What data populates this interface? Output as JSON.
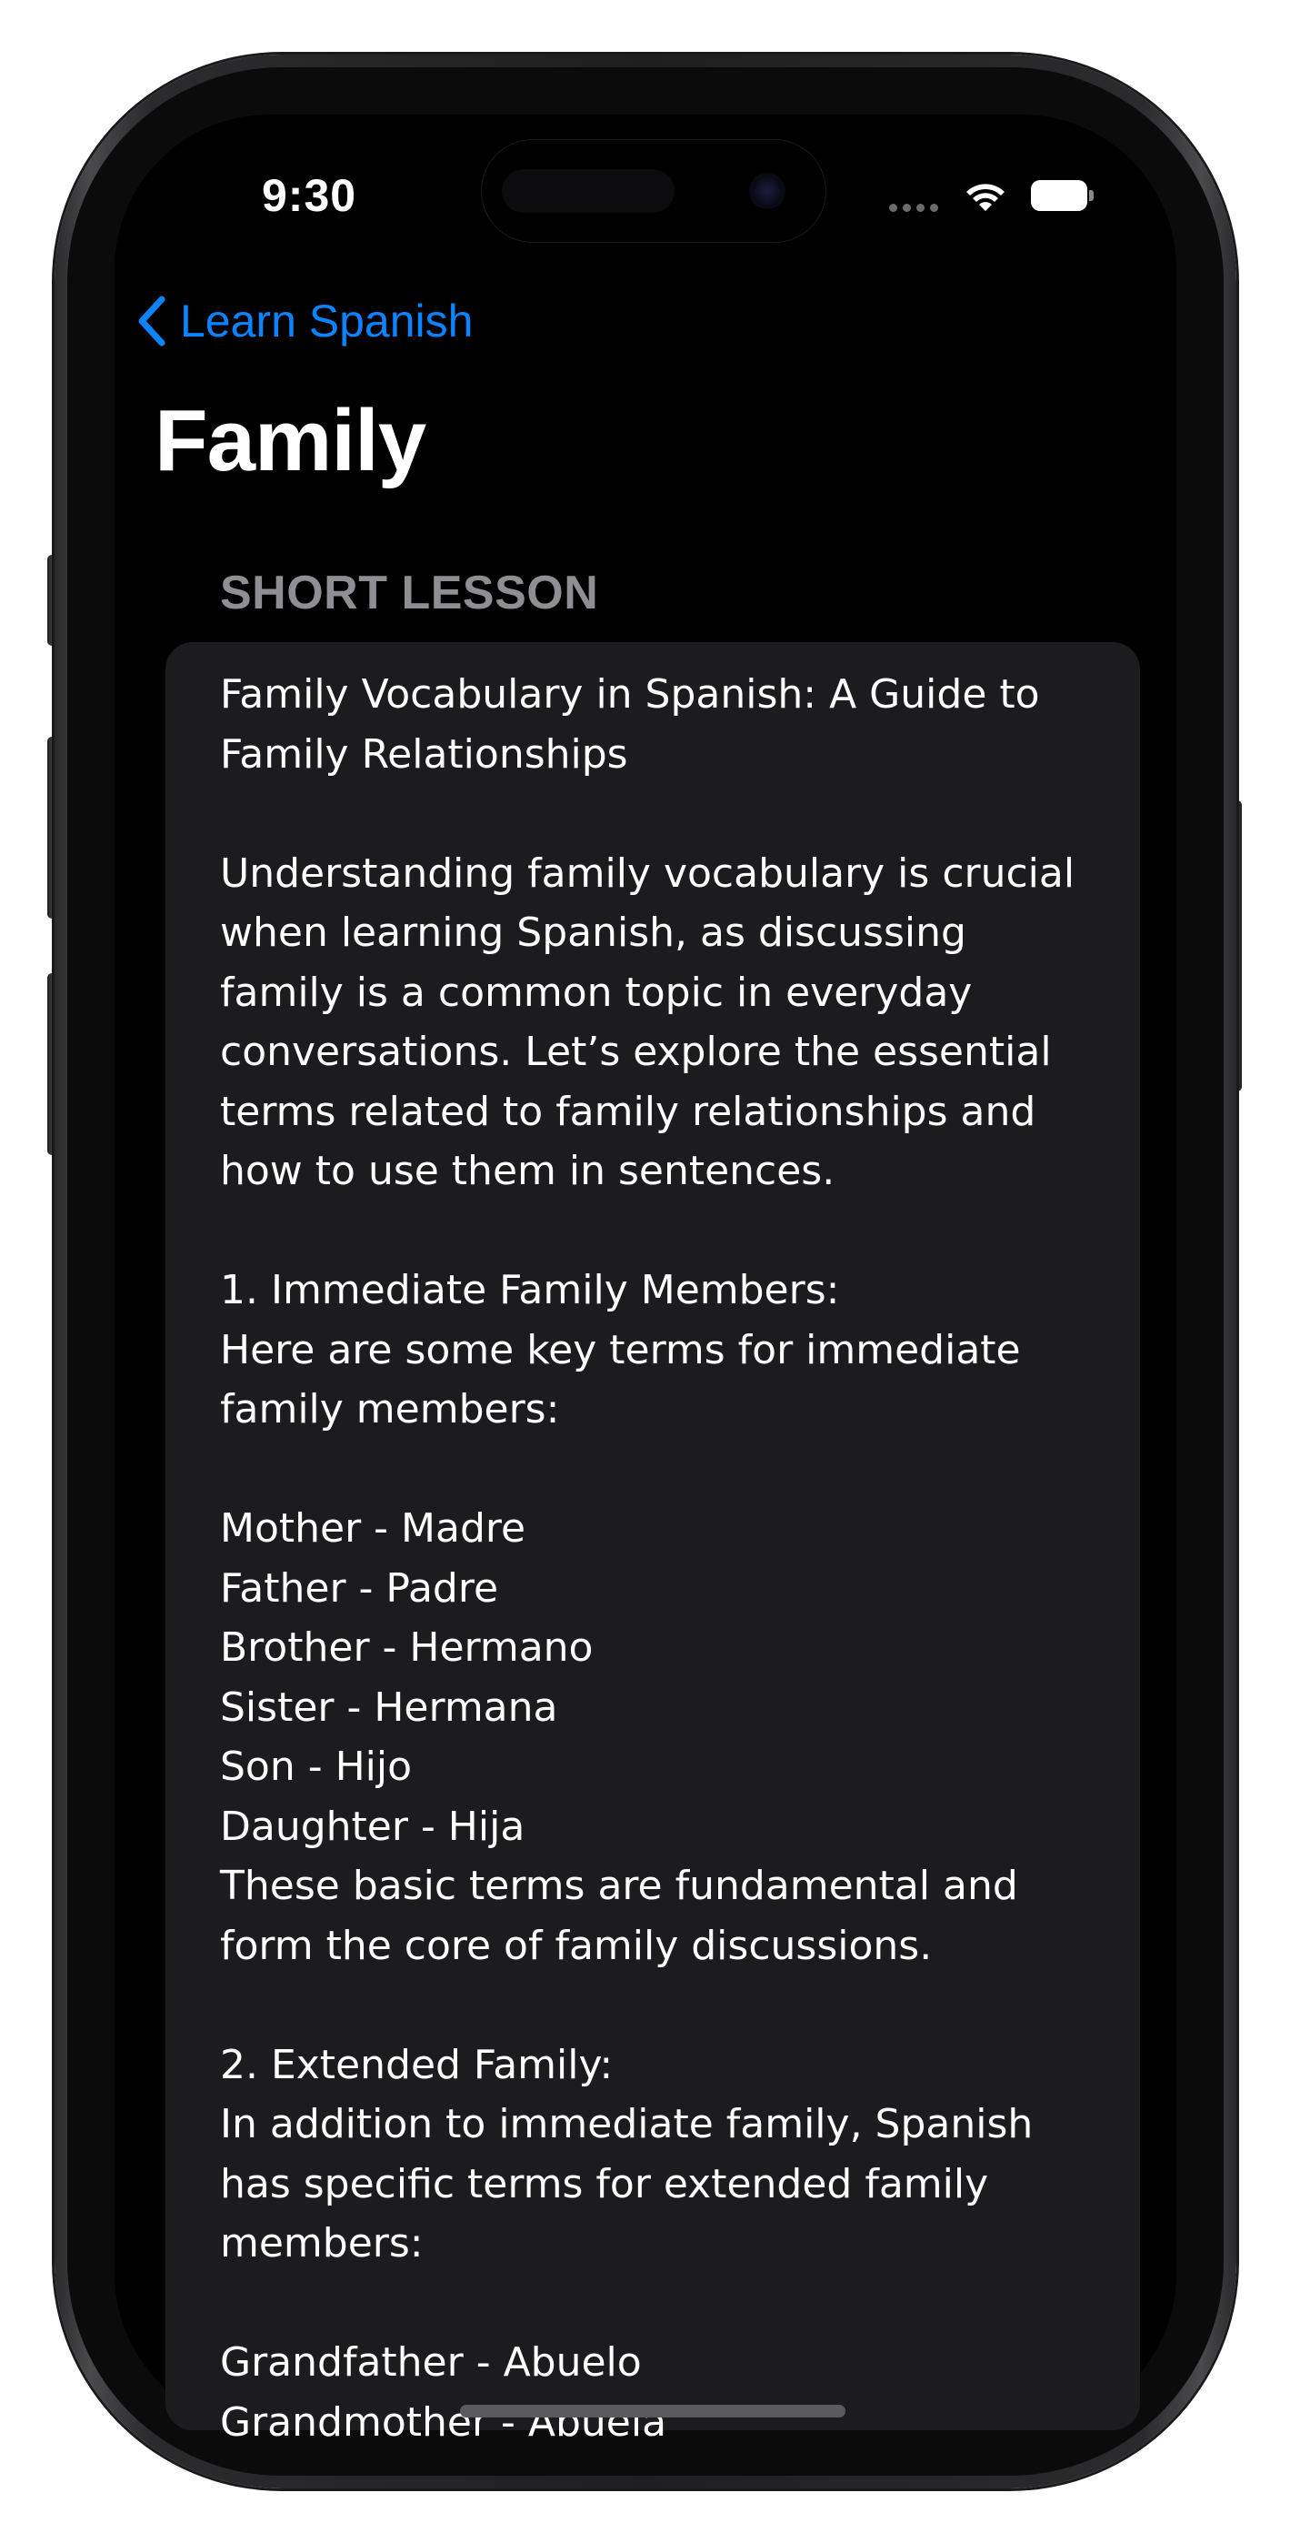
{
  "status_bar": {
    "time": "9:30"
  },
  "nav": {
    "back_label": "Learn Spanish",
    "title": "Family"
  },
  "section": {
    "header": "SHORT LESSON"
  },
  "lesson": {
    "text": "Family Vocabulary in Spanish: A Guide to\nFamily Relationships\n\nUnderstanding family vocabulary is crucial\nwhen learning Spanish, as discussing\nfamily is a common topic in everyday\nconversations. Let’s explore the essential\nterms related to family relationships and\nhow to use them in sentences.\n\n1. Immediate Family Members:\nHere are some key terms for immediate\nfamily members:\n\nMother - Madre\nFather - Padre\nBrother - Hermano\nSister - Hermana\nSon - Hijo\nDaughter - Hija\nThese basic terms are fundamental and\nform the core of family discussions.\n\n2. Extended Family:\nIn addition to immediate family, Spanish\nhas specific terms for extended family\nmembers:\n\nGrandfather - Abuelo\nGrandmother - Abuela"
  },
  "colors": {
    "accent": "#0a84ff",
    "background": "#000000",
    "card": "#1c1c1e",
    "secondary_text": "#8e8e93"
  }
}
